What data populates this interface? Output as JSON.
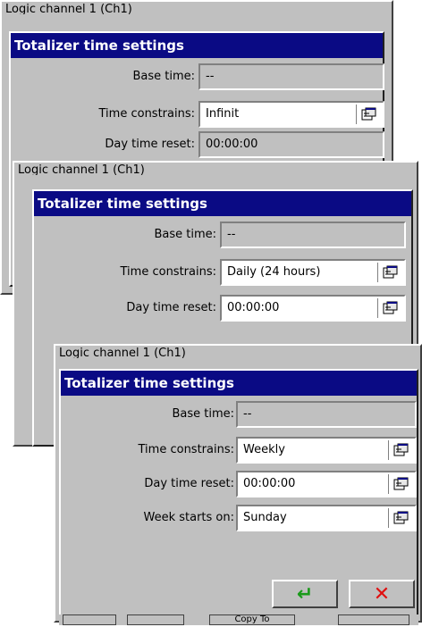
{
  "background_window_title": "Logic channel 1 (Ch1)",
  "dialog_title": "Totalizer time settings",
  "labels": {
    "base_time": "Base time:",
    "time_constrains": "Time constrains:",
    "day_time_reset": "Day time reset:",
    "week_starts_on": "Week starts on:"
  },
  "screen1": {
    "base_time": "--",
    "time_constrains": "Infinit",
    "day_time_reset": "00:00:00"
  },
  "screen2": {
    "base_time": "--",
    "time_constrains": "Daily (24 hours)",
    "day_time_reset": "00:00:00"
  },
  "screen3": {
    "base_time": "--",
    "time_constrains": "Weekly",
    "day_time_reset": "00:00:00",
    "week_starts_on": "Sunday"
  },
  "buttons": {
    "ok_symbol": "↵",
    "cancel_symbol": "✕",
    "copy_to_label": "Copy To"
  },
  "icons": {
    "picker": "edit-picker-icon",
    "ok": "enter-arrow-icon",
    "cancel": "close-icon"
  },
  "colors": {
    "titlebar": "#0a0a84",
    "window_bg": "#c0c0c0",
    "ok_green": "#1a9a1a",
    "cancel_red": "#e01010"
  }
}
